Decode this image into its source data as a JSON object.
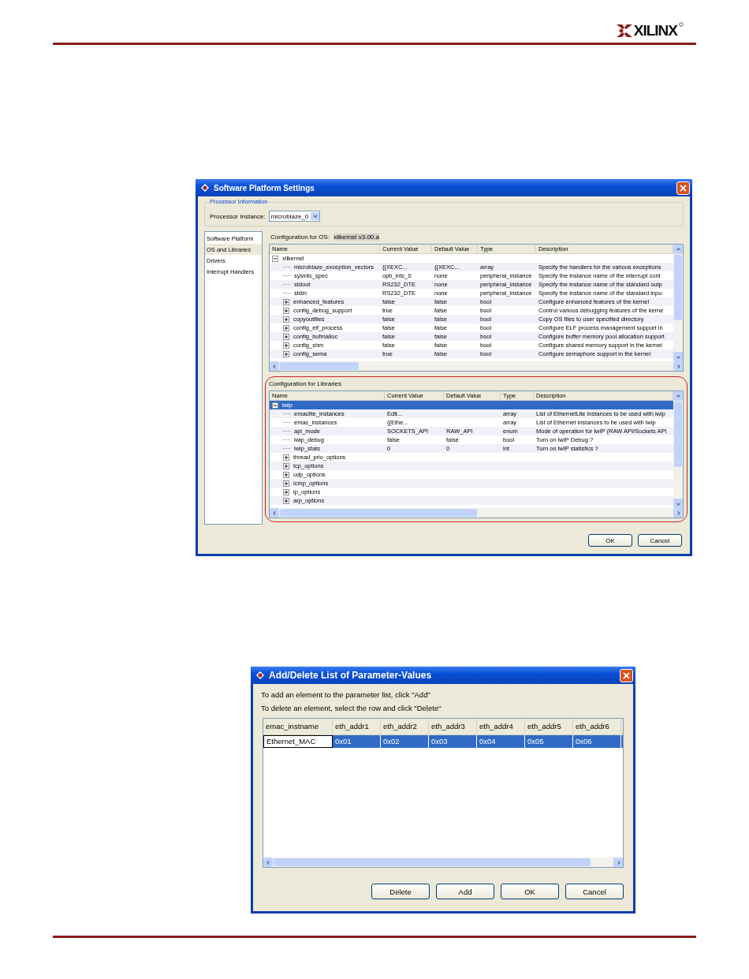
{
  "header": {
    "logo": "XILINX"
  },
  "platform_dialog": {
    "title": "Software Platform Settings",
    "processor": {
      "legend": "Processor Information",
      "label": "Processor Instance:",
      "value": "microblaze_0"
    },
    "nav": [
      {
        "label": "Software Platform",
        "selected": false
      },
      {
        "label": "OS and Libraries",
        "selected": true
      },
      {
        "label": "Drivers",
        "selected": false
      },
      {
        "label": "Interrupt Handlers",
        "selected": false
      }
    ],
    "os": {
      "label": "Configuration for OS:",
      "value": "xilkernel v3.00.a"
    },
    "os_table": {
      "columns": [
        "Name",
        "Current Value",
        "Default Value",
        "Type",
        "Description"
      ],
      "rows": [
        {
          "kind": "group",
          "name": "xilkernel",
          "expanded": true,
          "selected": false,
          "children": [
            {
              "kind": "leaf",
              "name": "microblaze_exception_vectors",
              "selected": false,
              "current": "{{XEXC...",
              "default": "{{XEXC...",
              "type": "array",
              "description": "Specify the handlers for the various exceptions"
            },
            {
              "kind": "leaf",
              "name": "sysintc_spec",
              "selected": false,
              "current": "opb_intc_0",
              "default": "none",
              "type": "peripheral_instance",
              "description": "Specify the instance name of the interrupt cont"
            },
            {
              "kind": "leaf",
              "name": "stdout",
              "selected": false,
              "current": "RS232_DTE",
              "default": "none",
              "type": "peripheral_instance",
              "description": "Specify the instance name of the standard outp"
            },
            {
              "kind": "leaf",
              "name": "stdin",
              "selected": false,
              "current": "RS232_DTE",
              "default": "none",
              "type": "peripheral_instance",
              "description": "Specify the instance name of the standard inpu"
            },
            {
              "kind": "group",
              "name": "enhanced_features",
              "expanded": false,
              "selected": false,
              "current": "false",
              "default": "false",
              "type": "bool",
              "description": "Configure enhanced features of the kernel"
            },
            {
              "kind": "group",
              "name": "config_debug_support",
              "expanded": false,
              "selected": false,
              "current": "true",
              "default": "false",
              "type": "bool",
              "description": "Control various debugging features of the kerne"
            },
            {
              "kind": "group",
              "name": "copyoutfiles",
              "expanded": false,
              "selected": false,
              "current": "false",
              "default": "false",
              "type": "bool",
              "description": "Copy OS files to user specified directory"
            },
            {
              "kind": "group",
              "name": "config_elf_process",
              "expanded": false,
              "selected": false,
              "current": "false",
              "default": "false",
              "type": "bool",
              "description": "Configure ELF process management support in"
            },
            {
              "kind": "group",
              "name": "config_bufmalloc",
              "expanded": false,
              "selected": false,
              "current": "false",
              "default": "false",
              "type": "bool",
              "description": "Configure buffer memory pool allocation support"
            },
            {
              "kind": "group",
              "name": "config_shm",
              "expanded": false,
              "selected": false,
              "current": "false",
              "default": "false",
              "type": "bool",
              "description": "Configure shared memory support in the kernel"
            },
            {
              "kind": "group",
              "name": "config_sema",
              "expanded": false,
              "selected": false,
              "current": "true",
              "default": "false",
              "type": "bool",
              "description": "Configure semaphore support in the kernel"
            }
          ]
        }
      ]
    },
    "libraries": {
      "label": "Configuration for Libraries",
      "highlighted": true,
      "table": {
        "columns": [
          "Name",
          "Current Value",
          "Default Value",
          "Type",
          "Description"
        ],
        "rows": [
          {
            "kind": "group",
            "name": "lwip",
            "expanded": true,
            "selected": true,
            "children": [
              {
                "kind": "leaf",
                "name": "emaclite_instances",
                "selected": false,
                "current": "Edit...",
                "type": "array",
                "description": "List of EthernetLite instances to be used with lwip"
              },
              {
                "kind": "leaf",
                "name": "emac_instances",
                "selected": false,
                "current": "{{Ethe...",
                "type": "array",
                "description": "List of Ethernet instances to be used with lwip"
              },
              {
                "kind": "leaf",
                "name": "api_mode",
                "selected": false,
                "current": "SOCKETS_API",
                "default": "RAW_API",
                "type": "enum",
                "description": "Mode of operation for lwIP (RAW API/Sockets API"
              },
              {
                "kind": "leaf",
                "name": "lwip_debug",
                "selected": false,
                "current": "false",
                "default": "false",
                "type": "bool",
                "description": "Turn on lwIP Debug ?"
              },
              {
                "kind": "leaf",
                "name": "lwip_stats",
                "selected": false,
                "current": "0",
                "default": "0",
                "type": "int",
                "description": "Turn on lwIP statistics ?"
              },
              {
                "kind": "group",
                "name": "thread_prio_options",
                "expanded": false,
                "selected": false
              },
              {
                "kind": "group",
                "name": "tcp_options",
                "expanded": false,
                "selected": false
              },
              {
                "kind": "group",
                "name": "udp_options",
                "expanded": false,
                "selected": false
              },
              {
                "kind": "group",
                "name": "icmp_options",
                "expanded": false,
                "selected": false
              },
              {
                "kind": "group",
                "name": "ip_options",
                "expanded": false,
                "selected": false
              },
              {
                "kind": "group",
                "name": "arp_options",
                "expanded": false,
                "selected": false
              }
            ]
          }
        ]
      }
    },
    "buttons": [
      "OK",
      "Cancel"
    ]
  },
  "params_dialog": {
    "title": "Add/Delete List of Parameter-Values",
    "instructions": [
      "To add an element to the parameter list, click \"Add\"",
      "To delete an element, select the row and click \"Delete\""
    ],
    "table": {
      "columns": [
        "emac_instname",
        "eth_addr1",
        "eth_addr2",
        "eth_addr3",
        "eth_addr4",
        "eth_addr5",
        "eth_addr6"
      ],
      "rows": [
        {
          "selected": true,
          "cells": [
            {
              "text": "Ethernet_MAC",
              "editing": true
            },
            {
              "text": "0x01",
              "editing": false
            },
            {
              "text": "0x02",
              "editing": false
            },
            {
              "text": "0x03",
              "editing": false
            },
            {
              "text": "0x04",
              "editing": false
            },
            {
              "text": "0x05",
              "editing": false
            },
            {
              "text": "0x06",
              "editing": false
            }
          ]
        }
      ]
    },
    "buttons": [
      "Delete",
      "Add",
      "OK",
      "Cancel"
    ]
  }
}
